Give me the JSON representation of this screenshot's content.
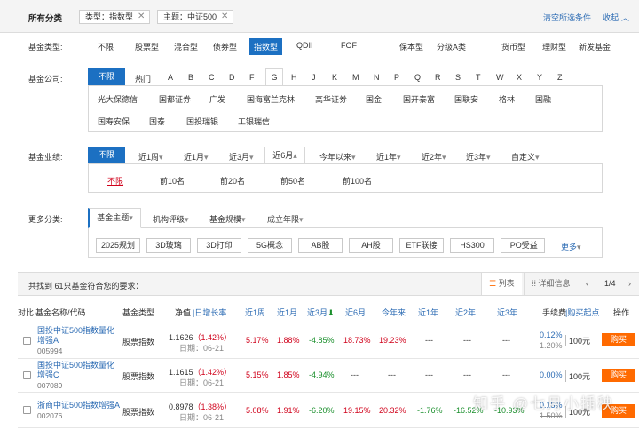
{
  "header": {
    "title": "所有分类",
    "tags": [
      {
        "text": "类型：指数型"
      },
      {
        "text": "主题：中证500"
      }
    ],
    "clear_label": "清空所选条件",
    "collapse_label": "收起"
  },
  "filters": {
    "type": {
      "label": "基金类型:",
      "options": [
        "不限",
        "股票型",
        "混合型",
        "债券型",
        "指数型",
        "QDII",
        "FOF",
        "保本型",
        "分级A类",
        "货币型",
        "理财型",
        "新发基金"
      ],
      "selected": "指数型"
    },
    "company": {
      "label": "基金公司:",
      "letters": [
        "不限",
        "热门",
        "A",
        "B",
        "C",
        "D",
        "F",
        "G",
        "H",
        "J",
        "K",
        "M",
        "N",
        "P",
        "Q",
        "R",
        "S",
        "T",
        "W",
        "X",
        "Y",
        "Z"
      ],
      "selected_letter": "G",
      "companies_row1": [
        "光大保德信",
        "国都证券",
        "广发",
        "国海富兰克林",
        "高华证券",
        "国金",
        "国开泰富",
        "国联安",
        "格林",
        "国融"
      ],
      "companies_row2": [
        "国寿安保",
        "国泰",
        "国投瑞银",
        "工银瑞信"
      ]
    },
    "performance": {
      "label": "基金业绩:",
      "periods": [
        "不限",
        "近1周",
        "近1月",
        "近3月",
        "近6月",
        "今年以来",
        "近1年",
        "近2年",
        "近3年",
        "自定义"
      ],
      "selected_period": "近6月",
      "ranks": [
        "不限",
        "前10名",
        "前20名",
        "前50名",
        "前100名"
      ]
    },
    "more": {
      "label": "更多分类:",
      "tabs": [
        "基金主题",
        "机构评级",
        "基金规模",
        "成立年限"
      ],
      "themes": [
        "2025规划",
        "3D玻璃",
        "3D打印",
        "5G概念",
        "AB股",
        "AH股",
        "ETF联接",
        "HS300",
        "IPO受益"
      ],
      "more_label": "更多"
    }
  },
  "results": {
    "count_text": "共找到 61只基金符合您的要求：",
    "view_list": "列表",
    "view_detail": "详细信息",
    "page": "1/4",
    "columns": {
      "compare": "对比",
      "name": "基金名称/代码",
      "type": "基金类型",
      "nav": "净值",
      "daily": "日增长率",
      "w1": "近1周",
      "m1": "近1月",
      "m3": "近3月",
      "m6": "近6月",
      "ytd": "今年来",
      "y1": "近1年",
      "y2": "近2年",
      "y3": "近3年",
      "fee": "手续费",
      "minbuy": "购买起点",
      "action": "操作"
    },
    "rows": [
      {
        "name": "国投中证500指数量化增强A",
        "code": "005994",
        "type": "股票指数",
        "nav": "1.1626",
        "daily": "（1.42%）",
        "date": "日期：06-21",
        "w1": "5.17%",
        "m1": "1.88%",
        "m3": "-4.85%",
        "m6": "18.73%",
        "ytd": "19.23%",
        "y1": "---",
        "y2": "---",
        "y3": "---",
        "fee_now": "0.12%",
        "fee_old": "1.20%",
        "minbuy": "100元",
        "buy": "购买"
      },
      {
        "name": "国投中证500指数量化增强C",
        "code": "007089",
        "type": "股票指数",
        "nav": "1.1615",
        "daily": "（1.42%）",
        "date": "日期：06-21",
        "w1": "5.15%",
        "m1": "1.85%",
        "m3": "-4.94%",
        "m6": "---",
        "ytd": "---",
        "y1": "---",
        "y2": "---",
        "y3": "---",
        "fee_now": "0.00%",
        "fee_old": "",
        "minbuy": "100元",
        "buy": "购买"
      },
      {
        "name": "浙商中证500指数增强A",
        "code": "002076",
        "type": "股票指数",
        "nav": "0.8978",
        "daily": "（1.38%）",
        "date": "日期：06-21",
        "w1": "5.08%",
        "m1": "1.91%",
        "m3": "-6.20%",
        "m6": "19.15%",
        "ytd": "20.32%",
        "y1": "-1.76%",
        "y2": "-16.52%",
        "y3": "-10.93%",
        "fee_now": "0.15%",
        "fee_old": "1.50%",
        "minbuy": "100元",
        "buy": "购买"
      }
    ]
  },
  "watermark": "知乎 @七月小插秧"
}
